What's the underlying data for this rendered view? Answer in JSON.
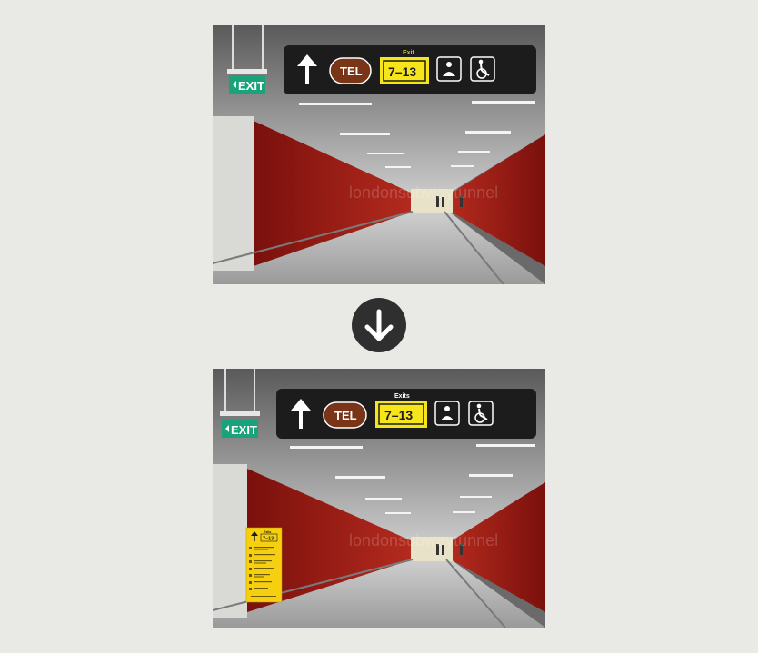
{
  "top_photo": {
    "exit_sign": "EXIT",
    "sign_caption": "Exit",
    "tel_label": "TEL",
    "exit_numbers": "7–13",
    "watermark": "londonsubwaytunnel"
  },
  "bottom_photo": {
    "exit_sign": "EXIT",
    "sign_caption": "Exits",
    "tel_label": "TEL",
    "exit_numbers": "7–13",
    "watermark": "londonsubwaytunnel",
    "panel": {
      "caption": "Exits",
      "numbers": "7–13"
    }
  },
  "arrow_icon": "arrow-down-circle-icon",
  "colors": {
    "sign_bg": "#1c1c1c",
    "exit_green": "#1aa37a",
    "tel_brown": "#7a3518",
    "exit_yellow": "#f6e51a",
    "wall_red": "#9b1a14",
    "background": "#e9e9e5"
  }
}
